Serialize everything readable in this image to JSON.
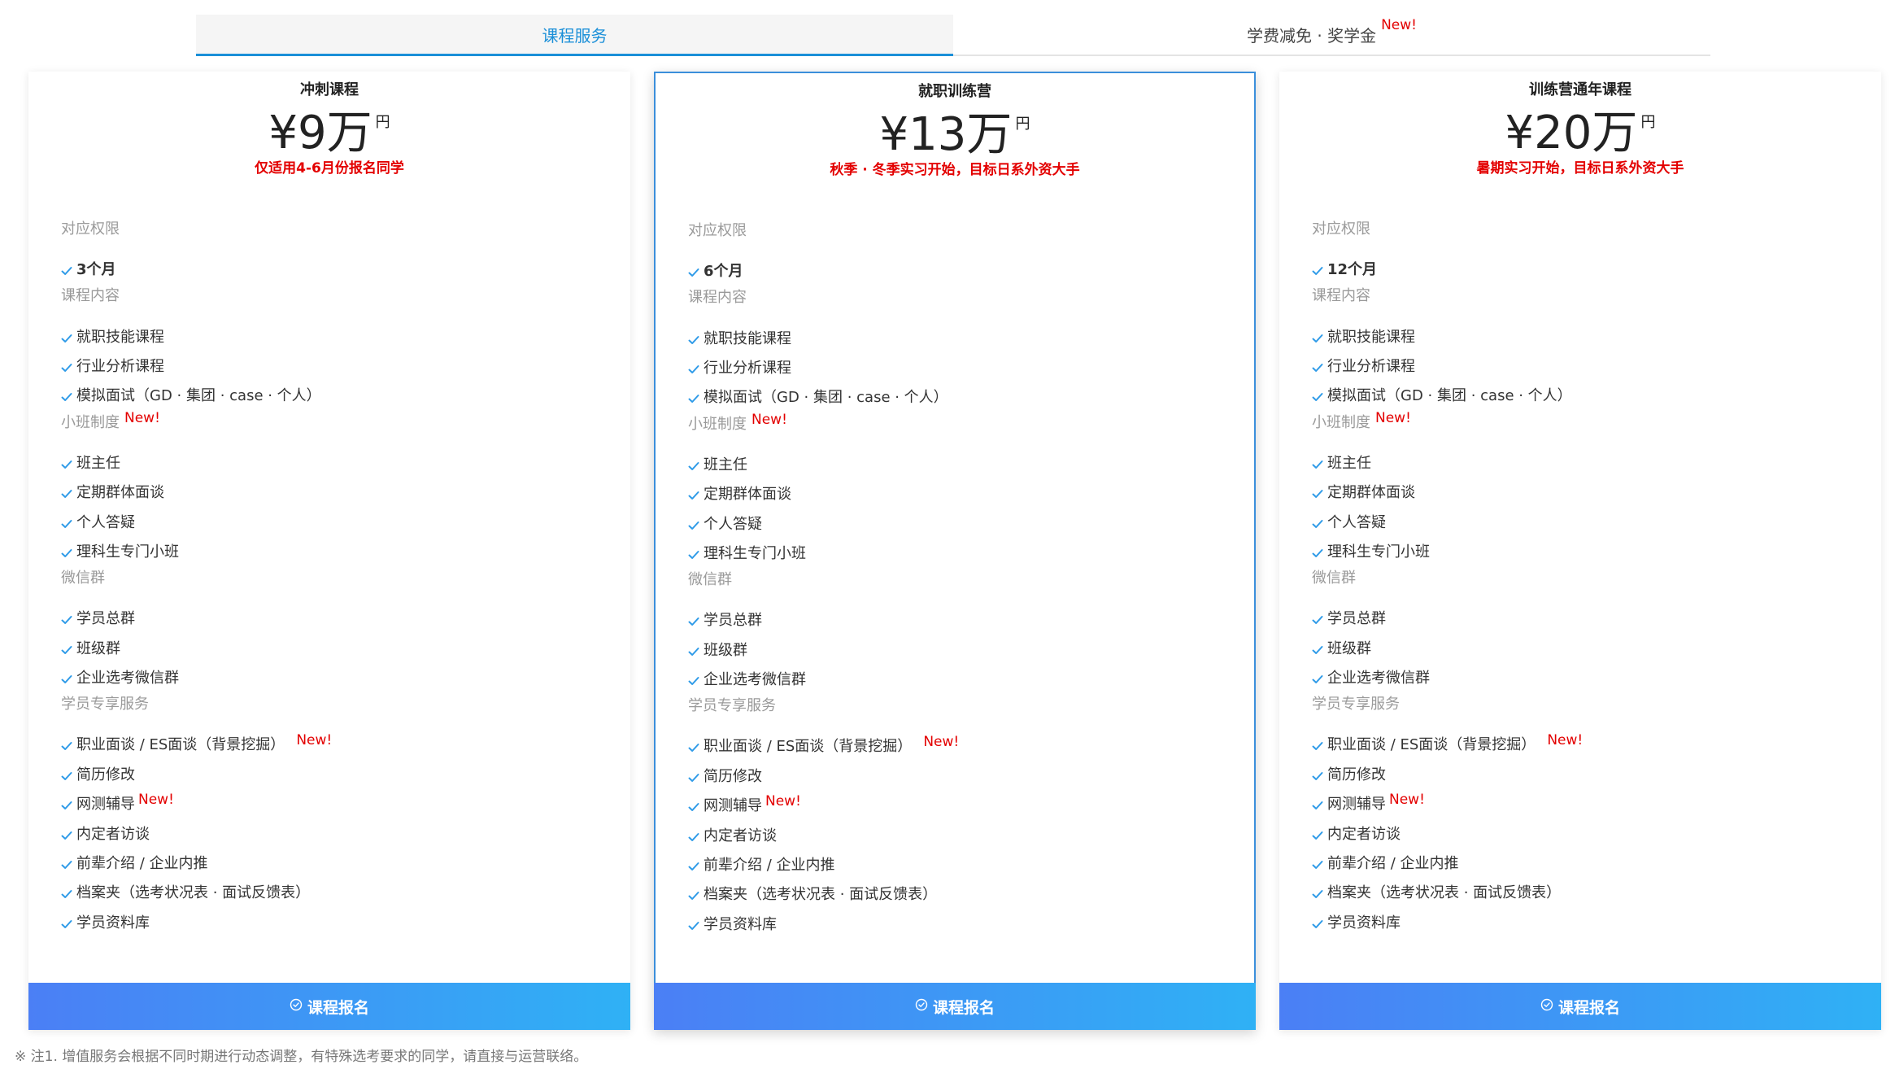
{
  "tabs": [
    {
      "label": "课程服务",
      "active": true
    },
    {
      "label": "学费减免 · 奖学金",
      "badge": "New!",
      "active": false
    }
  ],
  "new_badge": "New!",
  "cards": [
    {
      "title": "冲刺课程",
      "price": "¥9万",
      "price_unit": "円",
      "subtitle": "仅适用4-6月份报名同学",
      "duration": "3个月",
      "button": "课程报名"
    },
    {
      "title": "就职训练营",
      "price": "¥13万",
      "price_unit": "円",
      "subtitle": "秋季 · 冬季实习开始，目标日系外资大手",
      "duration": "6个月",
      "button": "课程报名"
    },
    {
      "title": "训练营通年课程",
      "price": "¥20万",
      "price_unit": "円",
      "subtitle": "暑期实习开始，目标日系外资大手",
      "duration": "12个月",
      "button": "课程报名"
    }
  ],
  "sections": {
    "rights": "对应权限",
    "content": "课程内容",
    "content_items": [
      "就职技能课程",
      "行业分析课程",
      "模拟面试（GD · 集团 · case · 个人）"
    ],
    "small_class": "小班制度",
    "small_class_items": [
      "班主任",
      "定期群体面谈",
      "个人答疑",
      "理科生专门小班"
    ],
    "wechat": "微信群",
    "wechat_items": [
      "学员总群",
      "班级群",
      "企业选考微信群"
    ],
    "exclusive": "学员专享服务",
    "exclusive_items": [
      {
        "label": "职业面谈 / ES面谈（背景挖掘）",
        "new": true
      },
      {
        "label": "简历修改",
        "new": false
      },
      {
        "label": "网测辅导",
        "new": true
      },
      {
        "label": "内定者访谈",
        "new": false
      },
      {
        "label": "前辈介绍 / 企业内推",
        "new": false
      },
      {
        "label": "档案夹（选考状况表 · 面试反馈表）",
        "new": false
      },
      {
        "label": "学员资料库",
        "new": false
      }
    ]
  },
  "footnote": "※ 注1. 增值服务会根据不同时期进行动态调整，有特殊选考要求的同学，请直接与运营联络。",
  "colors": {
    "accent": "#1a8fd8",
    "new_red": "#e30000",
    "check_blue": "#2f9be8",
    "button_gradient_start": "#4b7ff5",
    "button_gradient_end": "#2fb1f5"
  }
}
